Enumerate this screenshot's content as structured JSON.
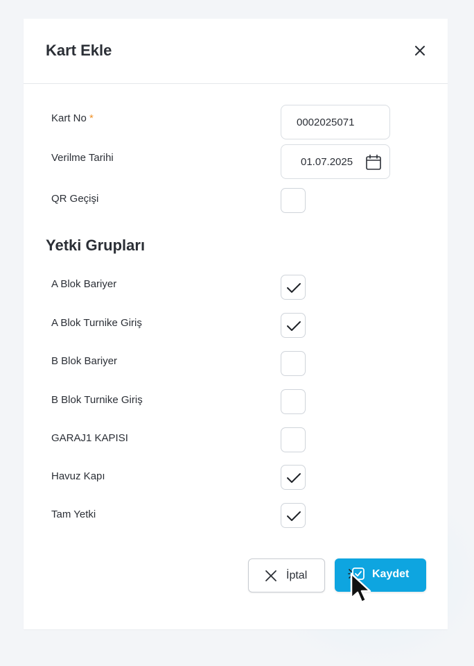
{
  "modal": {
    "title": "Kart Ekle",
    "close_icon": "close-icon"
  },
  "form": {
    "kart_no": {
      "label": "Kart No",
      "required_mark": "*",
      "value": "0002025071"
    },
    "verilme_tarihi": {
      "label": "Verilme Tarihi",
      "value": "01.07.2025",
      "icon": "calendar-icon"
    },
    "qr_gecisi": {
      "label": "QR Geçişi",
      "checked": false
    }
  },
  "permissions": {
    "title": "Yetki Grupları",
    "items": [
      {
        "label": "A Blok Bariyer",
        "checked": true
      },
      {
        "label": "A Blok Turnike Giriş",
        "checked": true
      },
      {
        "label": "B Blok Bariyer",
        "checked": false
      },
      {
        "label": "B Blok Turnike Giriş",
        "checked": false
      },
      {
        "label": "GARAJ1 KAPISI",
        "checked": false
      },
      {
        "label": "Havuz Kapı",
        "checked": true
      },
      {
        "label": "Tam Yetki",
        "checked": true
      }
    ]
  },
  "footer": {
    "cancel_label": "İptal",
    "cancel_icon": "x-icon",
    "save_label": "Kaydet",
    "save_icon": "save-icon",
    "save_color": "#0ea5e0"
  }
}
